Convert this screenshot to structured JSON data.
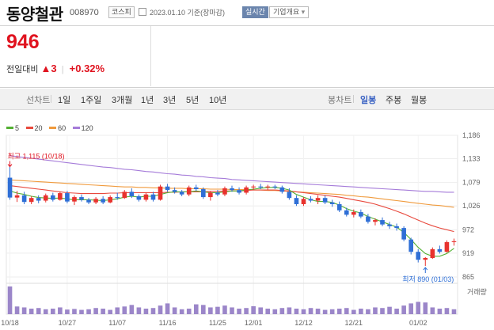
{
  "header": {
    "company_name": "동양철관",
    "code": "008970",
    "market_tag": "코스피",
    "date_text": "2023.01.10 기준(장마감)",
    "realtime_label": "실시간",
    "info_label": "기업개요",
    "info_chevron": "▾"
  },
  "price": {
    "current": "946",
    "change_label": "전일대비",
    "direction": "▲",
    "change": "3",
    "change_pct": "+0.32%",
    "up_color": "#e0131f"
  },
  "period_tabs": {
    "label": "선차트",
    "items": [
      "1일",
      "1주일",
      "3개월",
      "1년",
      "3년",
      "5년",
      "10년"
    ]
  },
  "candle_tabs": {
    "label": "봉차트",
    "items": [
      "일봉",
      "주봉",
      "월봉"
    ],
    "active": "일봉"
  },
  "chart_data": {
    "type": "candlestick",
    "moving_averages": [
      {
        "name": "5",
        "color": "#53b033"
      },
      {
        "name": "20",
        "color": "#e8493d"
      },
      {
        "name": "60",
        "color": "#f09a3c"
      },
      {
        "name": "120",
        "color": "#a57bd9"
      }
    ],
    "ylim": [
      865,
      1186
    ],
    "y_ticks": [
      1186,
      1133,
      1079,
      1026,
      972,
      919,
      865
    ],
    "x_ticks": [
      "10/18",
      "10/27",
      "11/07",
      "11/16",
      "11/25",
      "12/01",
      "12/12",
      "12/21",
      "01/02"
    ],
    "high_annotation": "최고 1,115 (10/18)",
    "low_annotation": "최저 890 (01/03)",
    "volume_label": "거래량",
    "candles": [
      [
        1090,
        1115,
        1040,
        1045
      ],
      [
        1045,
        1060,
        1035,
        1050
      ],
      [
        1050,
        1058,
        1030,
        1035
      ],
      [
        1035,
        1048,
        1030,
        1044
      ],
      [
        1044,
        1050,
        1032,
        1038
      ],
      [
        1038,
        1054,
        1034,
        1050
      ],
      [
        1050,
        1056,
        1036,
        1040
      ],
      [
        1040,
        1058,
        1038,
        1055
      ],
      [
        1055,
        1060,
        1032,
        1036
      ],
      [
        1036,
        1050,
        1028,
        1046
      ],
      [
        1046,
        1052,
        1036,
        1040
      ],
      [
        1040,
        1044,
        1030,
        1034
      ],
      [
        1034,
        1046,
        1030,
        1042
      ],
      [
        1042,
        1048,
        1030,
        1034
      ],
      [
        1034,
        1050,
        1032,
        1046
      ],
      [
        1046,
        1056,
        1040,
        1044
      ],
      [
        1044,
        1062,
        1042,
        1058
      ],
      [
        1058,
        1066,
        1044,
        1048
      ],
      [
        1048,
        1052,
        1036,
        1040
      ],
      [
        1040,
        1056,
        1036,
        1052
      ],
      [
        1052,
        1058,
        1036,
        1040
      ],
      [
        1040,
        1074,
        1038,
        1070
      ],
      [
        1070,
        1076,
        1058,
        1062
      ],
      [
        1062,
        1068,
        1054,
        1058
      ],
      [
        1058,
        1062,
        1048,
        1052
      ],
      [
        1052,
        1072,
        1048,
        1068
      ],
      [
        1068,
        1074,
        1060,
        1064
      ],
      [
        1064,
        1068,
        1042,
        1046
      ],
      [
        1046,
        1060,
        1038,
        1056
      ],
      [
        1056,
        1062,
        1048,
        1052
      ],
      [
        1052,
        1070,
        1048,
        1066
      ],
      [
        1066,
        1072,
        1058,
        1062
      ],
      [
        1062,
        1068,
        1052,
        1056
      ],
      [
        1056,
        1072,
        1052,
        1068
      ],
      [
        1068,
        1074,
        1062,
        1070
      ],
      [
        1070,
        1076,
        1064,
        1068
      ],
      [
        1068,
        1074,
        1062,
        1070
      ],
      [
        1070,
        1074,
        1064,
        1068
      ],
      [
        1068,
        1072,
        1054,
        1058
      ],
      [
        1058,
        1066,
        1040,
        1044
      ],
      [
        1044,
        1050,
        1026,
        1030
      ],
      [
        1030,
        1046,
        1026,
        1042
      ],
      [
        1042,
        1048,
        1034,
        1038
      ],
      [
        1038,
        1050,
        1030,
        1044
      ],
      [
        1044,
        1050,
        1030,
        1034
      ],
      [
        1034,
        1040,
        1024,
        1030
      ],
      [
        1030,
        1036,
        1012,
        1016
      ],
      [
        1016,
        1022,
        1002,
        1006
      ],
      [
        1006,
        1018,
        1000,
        1012
      ],
      [
        1012,
        1018,
        998,
        1002
      ],
      [
        1002,
        1008,
        986,
        990
      ],
      [
        990,
        998,
        982,
        994
      ],
      [
        994,
        1000,
        980,
        984
      ],
      [
        984,
        990,
        974,
        980
      ],
      [
        980,
        986,
        970,
        976
      ],
      [
        976,
        980,
        946,
        950
      ],
      [
        950,
        954,
        916,
        922
      ],
      [
        922,
        928,
        898,
        904
      ],
      [
        904,
        910,
        890,
        908
      ],
      [
        908,
        932,
        906,
        928
      ],
      [
        928,
        936,
        918,
        922
      ],
      [
        922,
        948,
        920,
        944
      ],
      [
        944,
        952,
        936,
        946
      ]
    ],
    "ma5": [
      1060,
      1055,
      1052,
      1048,
      1045,
      1044,
      1043,
      1044,
      1042,
      1040,
      1040,
      1040,
      1039,
      1038,
      1040,
      1042,
      1046,
      1048,
      1046,
      1048,
      1048,
      1052,
      1056,
      1058,
      1058,
      1058,
      1060,
      1058,
      1056,
      1056,
      1058,
      1060,
      1060,
      1062,
      1064,
      1066,
      1068,
      1068,
      1066,
      1062,
      1052,
      1046,
      1040,
      1036,
      1036,
      1034,
      1028,
      1020,
      1014,
      1010,
      1002,
      996,
      990,
      984,
      978,
      966,
      950,
      932,
      918,
      912,
      912,
      918,
      930
    ],
    "ma20": [
      1072,
      1070,
      1068,
      1066,
      1064,
      1062,
      1060,
      1058,
      1056,
      1055,
      1054,
      1054,
      1054,
      1054,
      1055,
      1055,
      1056,
      1056,
      1056,
      1056,
      1056,
      1056,
      1057,
      1057,
      1058,
      1058,
      1058,
      1058,
      1059,
      1059,
      1060,
      1060,
      1060,
      1061,
      1062,
      1062,
      1062,
      1062,
      1061,
      1060,
      1058,
      1056,
      1054,
      1052,
      1050,
      1048,
      1046,
      1043,
      1040,
      1037,
      1034,
      1030,
      1025,
      1020,
      1014,
      1008,
      1001,
      994,
      987,
      981,
      976,
      972,
      968
    ],
    "ma60": [
      1085,
      1084,
      1083,
      1082,
      1081,
      1080,
      1079,
      1078,
      1077,
      1076,
      1075,
      1074,
      1073,
      1072,
      1071,
      1070,
      1069,
      1069,
      1068,
      1068,
      1067,
      1067,
      1066,
      1066,
      1066,
      1065,
      1065,
      1065,
      1064,
      1064,
      1064,
      1063,
      1063,
      1063,
      1062,
      1062,
      1061,
      1061,
      1060,
      1059,
      1058,
      1057,
      1056,
      1055,
      1054,
      1053,
      1052,
      1050,
      1049,
      1047,
      1046,
      1044,
      1042,
      1040,
      1038,
      1036,
      1034,
      1032,
      1030,
      1028,
      1027,
      1025,
      1023
    ],
    "ma120": [
      1140,
      1138,
      1136,
      1134,
      1132,
      1130,
      1128,
      1126,
      1124,
      1122,
      1120,
      1118,
      1116,
      1114,
      1113,
      1111,
      1109,
      1108,
      1106,
      1104,
      1103,
      1101,
      1099,
      1098,
      1096,
      1095,
      1093,
      1092,
      1090,
      1089,
      1088,
      1086,
      1085,
      1084,
      1083,
      1082,
      1081,
      1080,
      1079,
      1078,
      1077,
      1076,
      1075,
      1074,
      1073,
      1072,
      1071,
      1070,
      1069,
      1068,
      1067,
      1066,
      1065,
      1064,
      1063,
      1062,
      1061,
      1060,
      1059,
      1059,
      1058,
      1057,
      1057
    ],
    "volumes": [
      90,
      25,
      22,
      18,
      20,
      16,
      18,
      22,
      15,
      17,
      14,
      16,
      20,
      18,
      14,
      22,
      25,
      30,
      22,
      18,
      20,
      28,
      35,
      22,
      16,
      18,
      32,
      30,
      22,
      24,
      28,
      22,
      18,
      20,
      26,
      22,
      18,
      16,
      20,
      22,
      18,
      16,
      20,
      18,
      14,
      16,
      18,
      20,
      14,
      18,
      16,
      22,
      20,
      24,
      18,
      28,
      35,
      40,
      38,
      22,
      18,
      20,
      16
    ]
  }
}
